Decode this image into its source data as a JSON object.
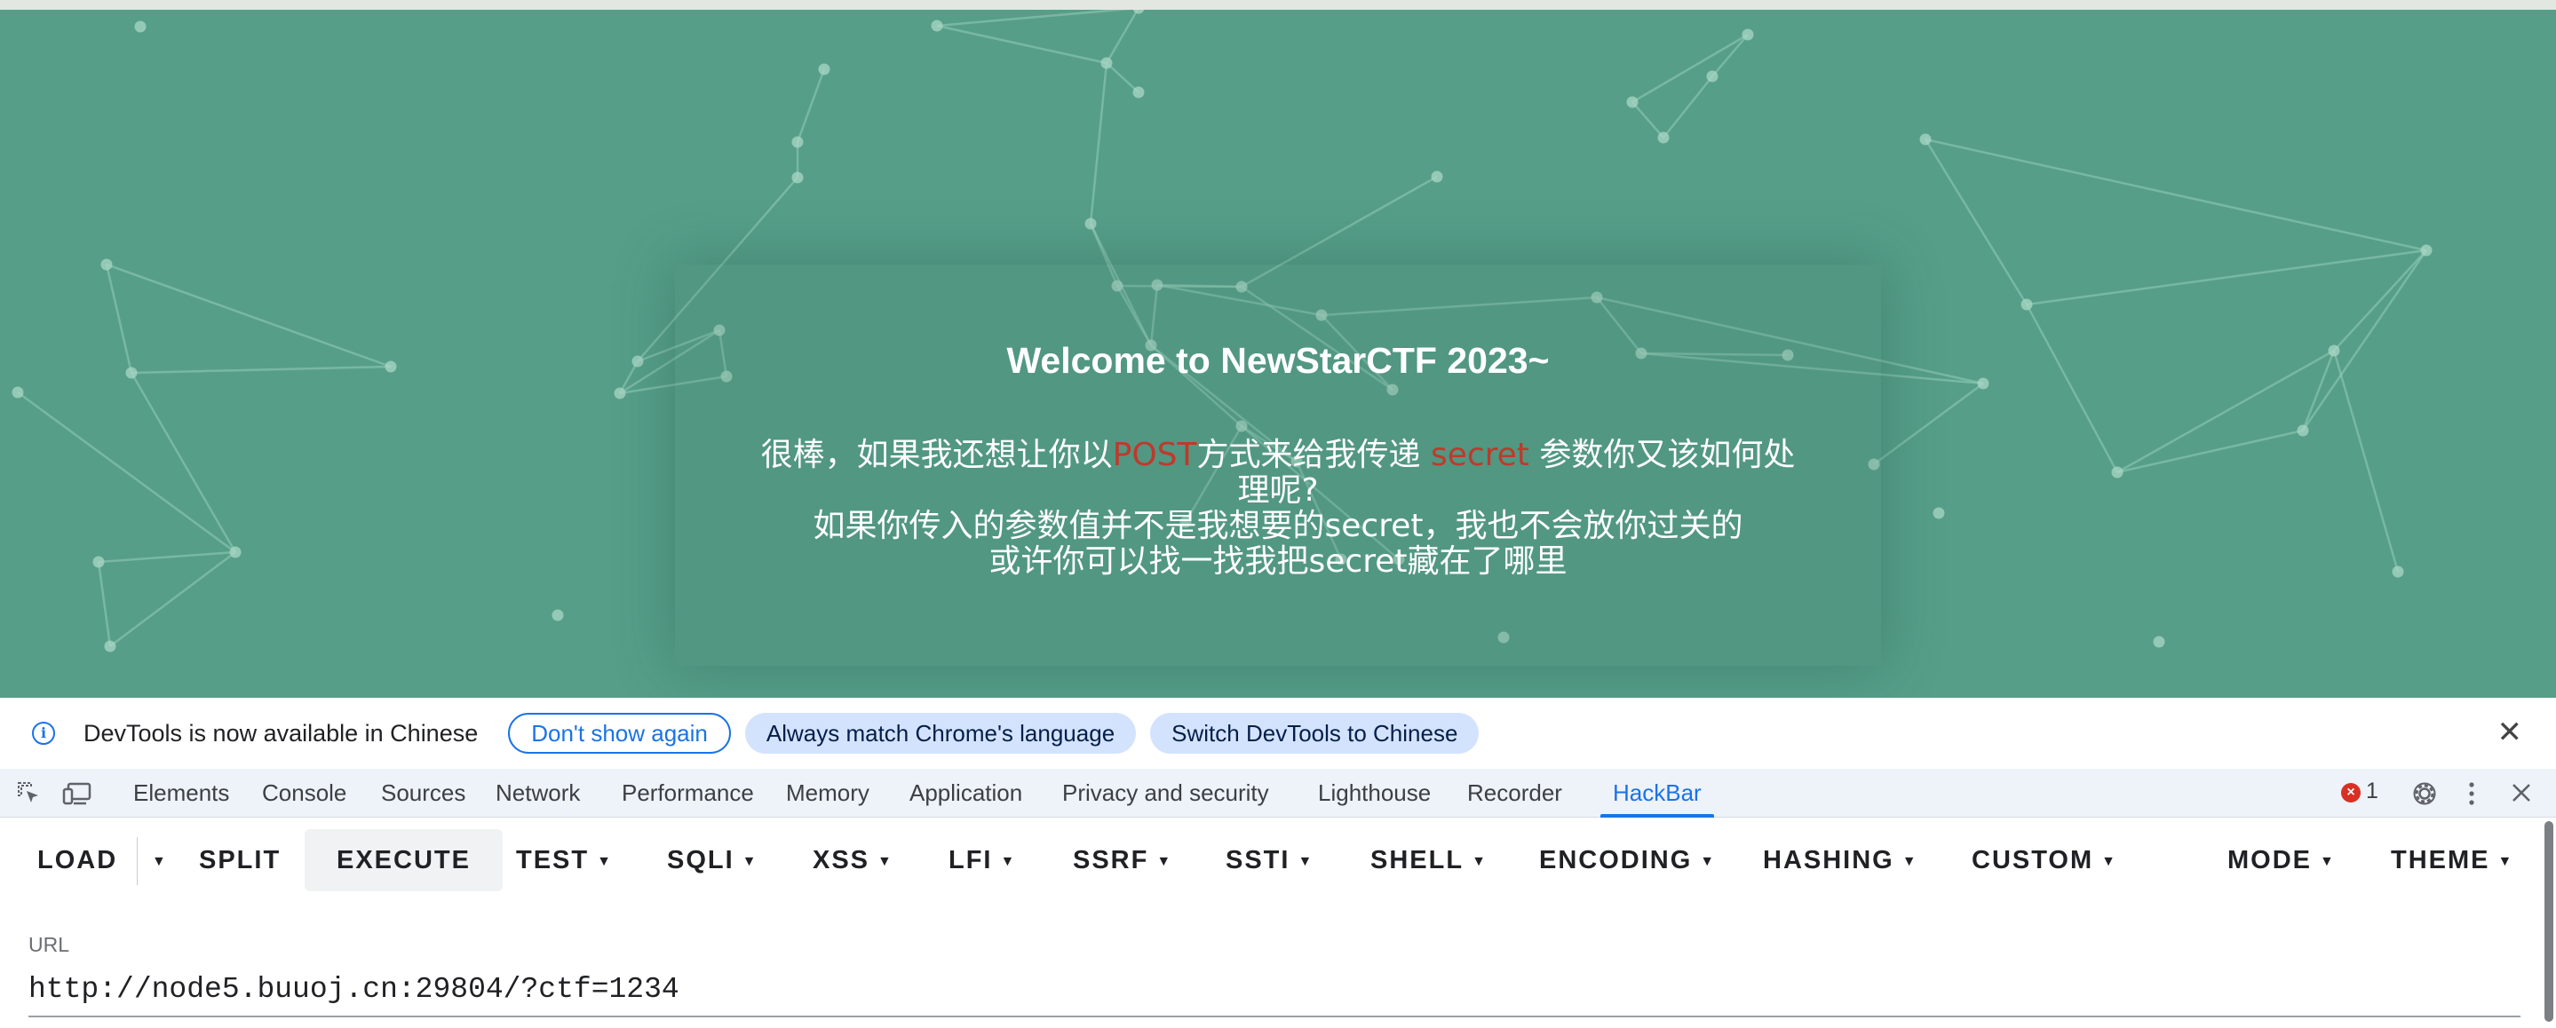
{
  "webpage": {
    "title": "Welcome to NewStarCTF 2023~",
    "lines": [
      {
        "before": "很棒，如果我还想让你以",
        "red1": "POST",
        "middle": "方式来给我传递 ",
        "red2": "secret",
        "after": " 参数你又该如何处理呢?"
      },
      "如果你传入的参数值并不是我想要的secret，我也不会放你过关的",
      "或许你可以找一找我把secret藏在了哪里"
    ]
  },
  "infobar": {
    "message": "DevTools is now available in Chinese",
    "dont_show": "Don't show again",
    "always_match": "Always match Chrome's language",
    "switch": "Switch DevTools to Chinese",
    "close": "✕"
  },
  "tabs": [
    "Elements",
    "Console",
    "Sources",
    "Network",
    "Performance",
    "Memory",
    "Application",
    "Privacy and security",
    "Lighthouse",
    "Recorder",
    "HackBar"
  ],
  "active_tab": "HackBar",
  "error_count": "1",
  "hackbar": {
    "load": "LOAD",
    "split": "SPLIT",
    "execute": "EXECUTE",
    "test": "TEST",
    "sqli": "SQLI",
    "xss": "XSS",
    "lfi": "LFI",
    "ssrf": "SSRF",
    "ssti": "SSTI",
    "shell": "SHELL",
    "encoding": "ENCODING",
    "hashing": "HASHING",
    "custom": "CUSTOM",
    "mode": "MODE",
    "theme": "THEME"
  },
  "url": {
    "label": "URL",
    "value": "http://node5.buuoj.cn:29804/?ctf=1234"
  },
  "colors": {
    "page_bg": "#569e88",
    "accent": "#1a73e8",
    "highlight_red": "#c0392b",
    "error": "#d93025"
  }
}
